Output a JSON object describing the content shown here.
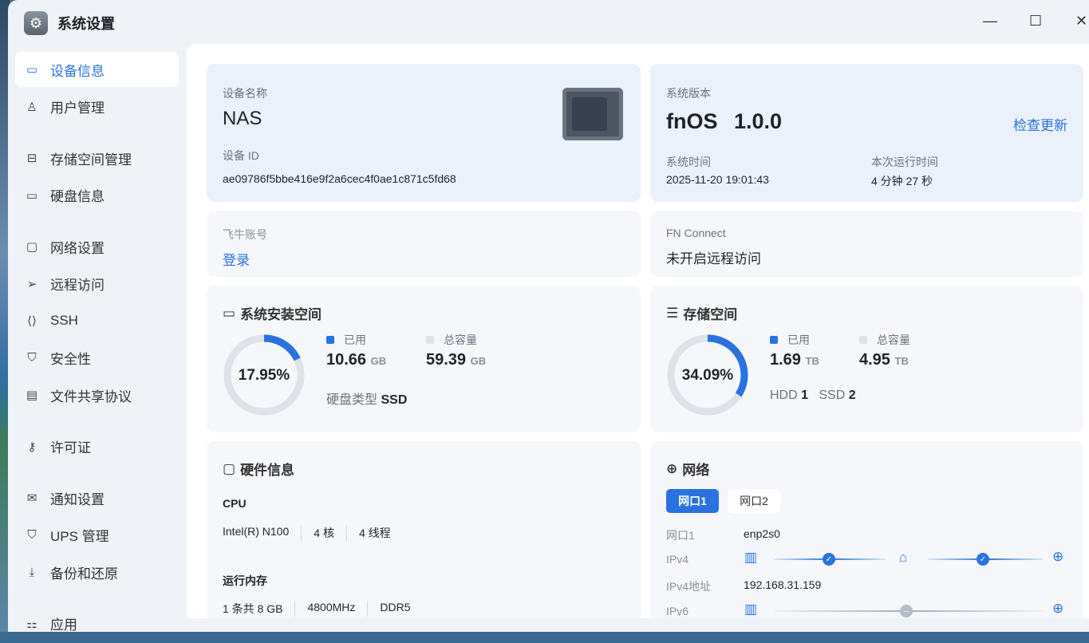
{
  "window": {
    "title": "系统设置",
    "minimize": "—",
    "maximize": "☐",
    "close": "✕"
  },
  "sidebar": {
    "items": [
      {
        "label": "设备信息",
        "icon": "drive-icon",
        "glyph": "▭"
      },
      {
        "label": "用户管理",
        "icon": "user-gear-icon",
        "glyph": "♙"
      },
      {
        "label": "存储空间管理",
        "icon": "inbox-icon",
        "glyph": "⊟"
      },
      {
        "label": "硬盘信息",
        "icon": "disk-icon",
        "glyph": "▭"
      },
      {
        "label": "网络设置",
        "icon": "network-icon",
        "glyph": "▢"
      },
      {
        "label": "远程访问",
        "icon": "send-icon",
        "glyph": "➢"
      },
      {
        "label": "SSH",
        "icon": "code-icon",
        "glyph": "⟨⟩"
      },
      {
        "label": "安全性",
        "icon": "shield-icon",
        "glyph": "⛉"
      },
      {
        "label": "文件共享协议",
        "icon": "file-icon",
        "glyph": "▤"
      },
      {
        "label": "许可证",
        "icon": "key-icon",
        "glyph": "⚷"
      },
      {
        "label": "通知设置",
        "icon": "mail-icon",
        "glyph": "✉"
      },
      {
        "label": "UPS 管理",
        "icon": "shield-outline-icon",
        "glyph": "⛉"
      },
      {
        "label": "备份和还原",
        "icon": "download-icon",
        "glyph": "⤓"
      },
      {
        "label": "应用",
        "icon": "apps-icon",
        "glyph": "⚏"
      }
    ]
  },
  "device": {
    "name_label": "设备名称",
    "name": "NAS",
    "id_label": "设备 ID",
    "id": "ae09786f5bbe416e9f2a6cec4f0ae1c871c5fd68"
  },
  "system": {
    "version_label": "系统版本",
    "os": "fnOS",
    "version": "1.0.0",
    "check_update": "检查更新",
    "time_label": "系统时间",
    "time": "2025-11-20 19:01:43",
    "uptime_label": "本次运行时间",
    "uptime": "4 分钟 27 秒"
  },
  "account": {
    "label": "飞牛账号",
    "login": "登录"
  },
  "connect": {
    "label": "FN Connect",
    "status": "未开启远程访问"
  },
  "sys_space": {
    "title": "系统安装空间",
    "percent": "17.95%",
    "fraction": 0.1795,
    "used_label": "已用",
    "used": "10.66",
    "used_unit": "GB",
    "total_label": "总容量",
    "total": "59.39",
    "total_unit": "GB",
    "disk_type_label": "硬盘类型",
    "disk_type": "SSD"
  },
  "storage": {
    "title": "存储空间",
    "percent": "34.09%",
    "fraction": 0.3409,
    "used_label": "已用",
    "used": "1.69",
    "used_unit": "TB",
    "total_label": "总容量",
    "total": "4.95",
    "total_unit": "TB",
    "hdd_label": "HDD",
    "hdd": "1",
    "ssd_label": "SSD",
    "ssd": "2"
  },
  "hardware": {
    "title": "硬件信息",
    "cpu_label": "CPU",
    "cpu": [
      "Intel(R) N100",
      "4 核",
      "4 线程"
    ],
    "mem_label": "运行内存",
    "mem": [
      "1 条共 8 GB",
      "4800MHz",
      "DDR5"
    ]
  },
  "network": {
    "title": "网络",
    "tabs": [
      "网口1",
      "网口2"
    ],
    "port_label": "网口1",
    "port": "enp2s0",
    "ipv4_label": "IPv4",
    "ipv4_addr_label": "IPv4地址",
    "ipv4_addr": "192.168.31.159",
    "ipv6_label": "IPv6"
  },
  "colors": {
    "accent": "#2a72e0",
    "track": "#dfe2e8"
  }
}
